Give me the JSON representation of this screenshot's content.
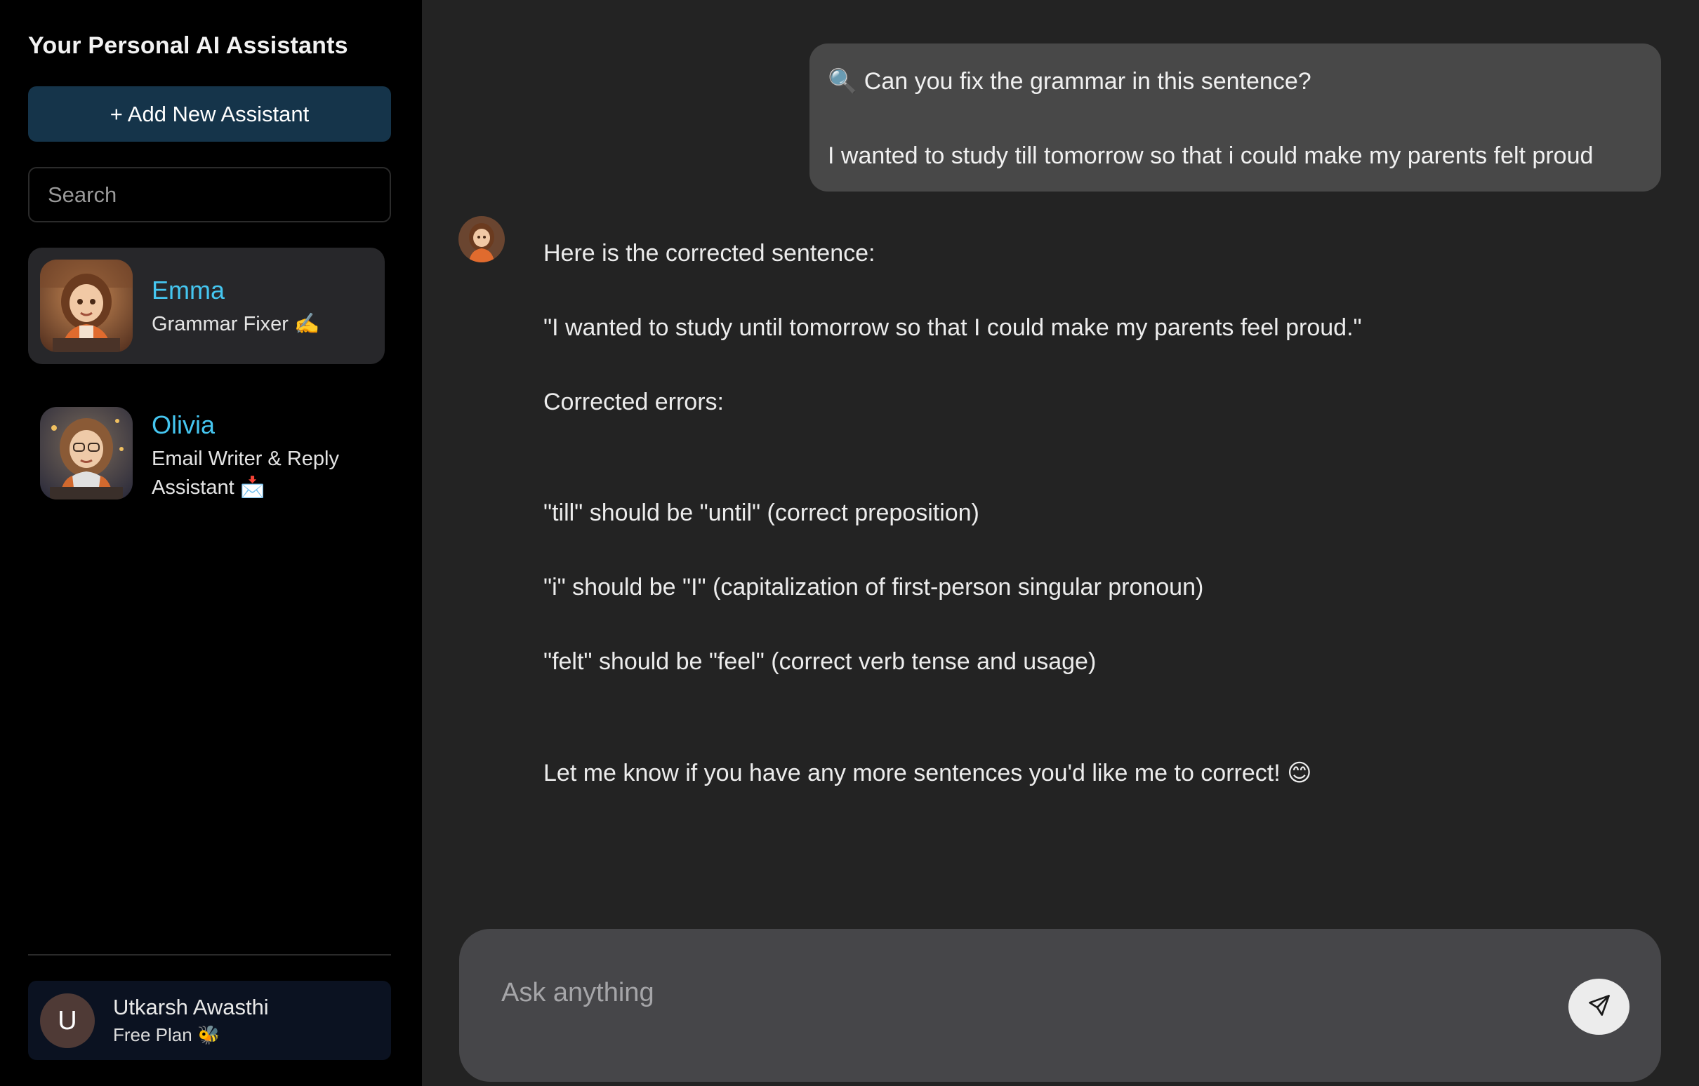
{
  "sidebar": {
    "title": "Your Personal AI Assistants",
    "add_button_label": "+ Add New Assistant",
    "search_placeholder": "Search",
    "assistants": [
      {
        "name": "Emma",
        "role": "Grammar Fixer ✍️",
        "active": true,
        "icon": "emma-avatar"
      },
      {
        "name": "Olivia",
        "role": "Email Writer & Reply Assistant 📩",
        "active": false,
        "icon": "olivia-avatar"
      }
    ],
    "user": {
      "initial": "U",
      "name": "Utkarsh Awasthi",
      "plan": "Free Plan 🐝"
    }
  },
  "chat": {
    "user_message": {
      "line1": "🔍 Can you fix the grammar in this sentence?",
      "line2": "I wanted to study till tomorrow so that i could make my parents felt proud"
    },
    "assistant_message": {
      "intro": "Here is the corrected sentence:",
      "corrected": "\"I wanted to study until tomorrow so that I could make my parents feel proud.\"",
      "errors_heading": "Corrected errors:",
      "errors": [
        "\"till\" should be \"until\" (correct preposition)",
        "\"i\" should be \"I\" (capitalization of first-person singular pronoun)",
        "\"felt\" should be \"feel\" (correct verb tense and usage)"
      ],
      "closing": "Let me know if you have any more sentences you'd like me to correct! 😊"
    },
    "composer": {
      "placeholder": "Ask anything",
      "send_icon": "send-icon"
    }
  },
  "colors": {
    "sidebar_bg": "#000000",
    "main_bg": "#232323",
    "accent_name": "#45c6f0",
    "add_button_bg": "#15344a",
    "user_bubble_bg": "#484848",
    "composer_bg": "#464649"
  }
}
